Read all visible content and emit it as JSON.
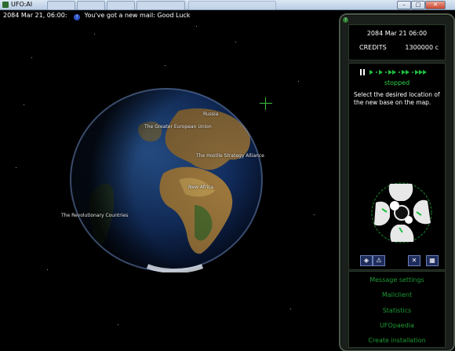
{
  "window": {
    "title": "UFO:AI",
    "buttons": {
      "minimize": "–",
      "maximize": "□",
      "close": "✕"
    }
  },
  "topbar": {
    "datetime": "2084 Mar 21, 06:00:",
    "mail_icon": "!",
    "message": "You've got a new mail: Good Luck"
  },
  "globe": {
    "regions": [
      "Russia",
      "The Greater European Union",
      "The Hostile Strategy Alliance",
      "New Africa",
      "The Revolutionary Countries"
    ]
  },
  "panel": {
    "corner_icon": "?",
    "date": "2084 Mar 21 06:00",
    "credits_label": "CREDITS",
    "credits_value": "1300000 c",
    "status": "stopped",
    "message": "Select the desired location of the new base on the map.",
    "icon_buttons": [
      "base-icon",
      "team-icon",
      "cross-icon",
      "grid-icon"
    ],
    "icon_glyphs": [
      "◈",
      "⚠",
      "✕",
      "▦"
    ],
    "menu": [
      "Message settings",
      "Mailclient",
      "Statistics",
      "UFOpaedia",
      "Create installation"
    ]
  },
  "colors": {
    "accent_green": "#2fd24a",
    "menu_green": "#1c9a34",
    "ocean": "#1b3a6b"
  }
}
